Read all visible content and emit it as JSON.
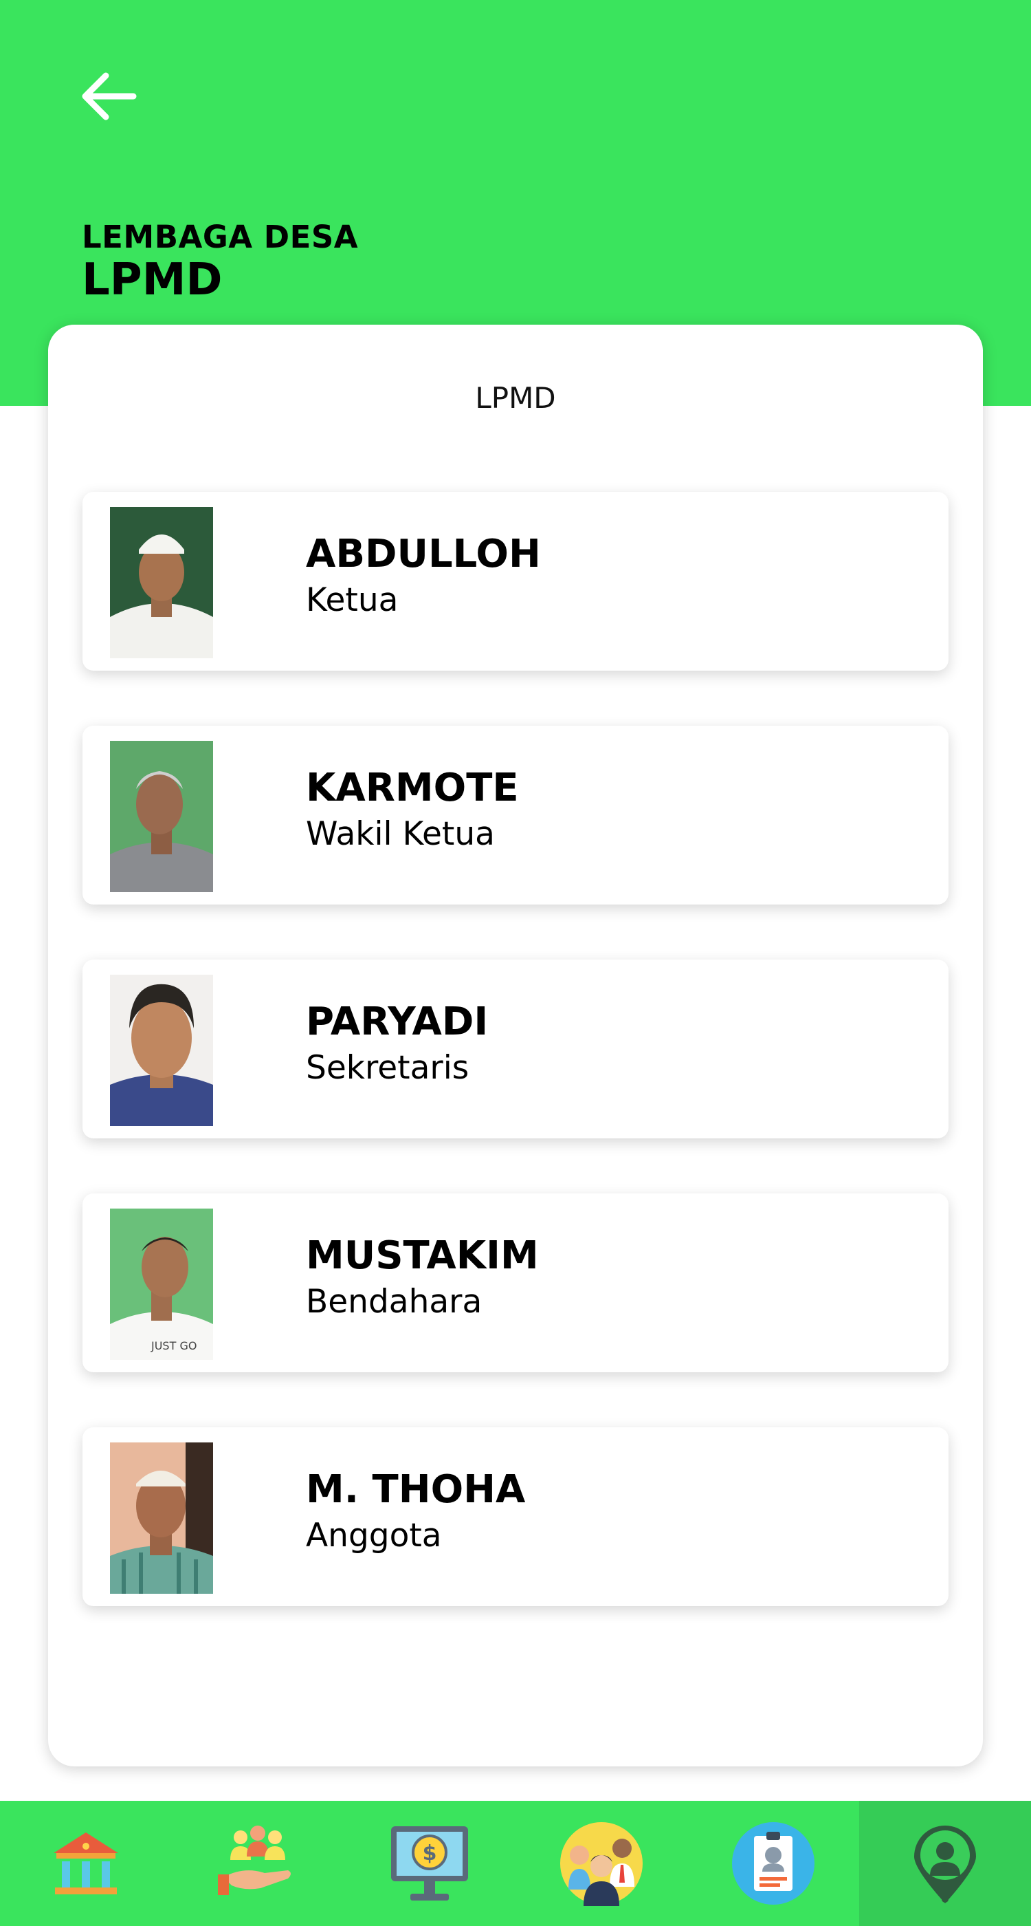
{
  "header": {
    "subtitle": "LEMBAGA DESA",
    "title": "LPMD"
  },
  "card": {
    "title": "LPMD"
  },
  "members": [
    {
      "name": "ABDULLOH",
      "role": "Ketua"
    },
    {
      "name": "KARMOTE",
      "role": "Wakil Ketua"
    },
    {
      "name": "PARYADI",
      "role": "Sekretaris"
    },
    {
      "name": "MUSTAKIM",
      "role": "Bendahara"
    },
    {
      "name": "M. THOHA",
      "role": "Anggota"
    }
  ],
  "bottom_nav": {
    "items": [
      {
        "icon": "bank-icon"
      },
      {
        "icon": "community-hand-icon"
      },
      {
        "icon": "finance-monitor-icon"
      },
      {
        "icon": "people-group-icon"
      },
      {
        "icon": "id-card-icon"
      },
      {
        "icon": "location-person-icon",
        "active": true
      }
    ]
  },
  "colors": {
    "primary_green": "#3ae45d",
    "active_nav": "#35cc56",
    "card_bg": "#ffffff",
    "text": "#000000"
  }
}
